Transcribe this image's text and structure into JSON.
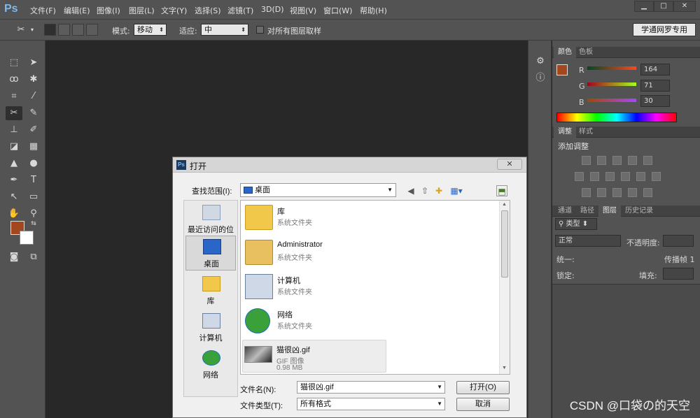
{
  "app": {
    "logo": "Ps"
  },
  "menu": [
    "文件(F)",
    "编辑(E)",
    "图像(I)",
    "图层(L)",
    "文字(Y)",
    "选择(S)",
    "滤镜(T)",
    "3D(D)",
    "视图(V)",
    "窗口(W)",
    "帮助(H)"
  ],
  "options": {
    "mode_label": "模式:",
    "mode_value": "移动",
    "adapt_label": "适应:",
    "adapt_value": "中",
    "sample_all_label": "对所有图层取样",
    "workspace": "学通网罗专用"
  },
  "colors": {
    "foreground": "#a4471e",
    "background": "#ffffff",
    "accent": "#7fb8ea"
  },
  "color_panel": {
    "tabs": [
      "颜色",
      "色板"
    ],
    "channels": [
      {
        "label": "R",
        "value": "164"
      },
      {
        "label": "G",
        "value": "71"
      },
      {
        "label": "B",
        "value": "30"
      }
    ]
  },
  "adjust_panel": {
    "tabs": [
      "调整",
      "样式"
    ],
    "title": "添加调整"
  },
  "layers_panel": {
    "tabs": [
      "通道",
      "路径",
      "图层",
      "历史记录"
    ],
    "filter_kind": "类型",
    "blend_mode": "正常",
    "opacity_label": "不透明度:",
    "unify_label": "统一:",
    "propagate_label": "传播帧 1",
    "lock_label": "锁定:",
    "fill_label": "填充:"
  },
  "dialog": {
    "title": "打开",
    "look_in_label": "查找范围(I):",
    "look_in_value": "桌面",
    "places": [
      {
        "label": "最近访问的位置",
        "icon": "recent-places-icon"
      },
      {
        "label": "桌面",
        "icon": "desktop-icon"
      },
      {
        "label": "库",
        "icon": "libraries-icon"
      },
      {
        "label": "计算机",
        "icon": "computer-icon"
      },
      {
        "label": "网络",
        "icon": "network-icon"
      }
    ],
    "files": [
      {
        "name": "库",
        "type": "系统文件夹",
        "icon": "libraries-folder-icon"
      },
      {
        "name": "Administrator",
        "type": "系统文件夹",
        "icon": "user-folder-icon"
      },
      {
        "name": "计算机",
        "type": "系统文件夹",
        "icon": "computer-icon"
      },
      {
        "name": "网络",
        "type": "系统文件夹",
        "icon": "network-icon"
      },
      {
        "name": "猫很凶.gif",
        "type": "GIF 图像",
        "size": "0.98 MB",
        "icon": "gif-thumbnail"
      }
    ],
    "filename_label": "文件名(N):",
    "filename_value": "猫很凶.gif",
    "filetype_label": "文件类型(T):",
    "filetype_value": "所有格式",
    "open_button": "打开(O)",
    "cancel_button": "取消"
  },
  "watermark": "CSDN @口袋の的天空"
}
